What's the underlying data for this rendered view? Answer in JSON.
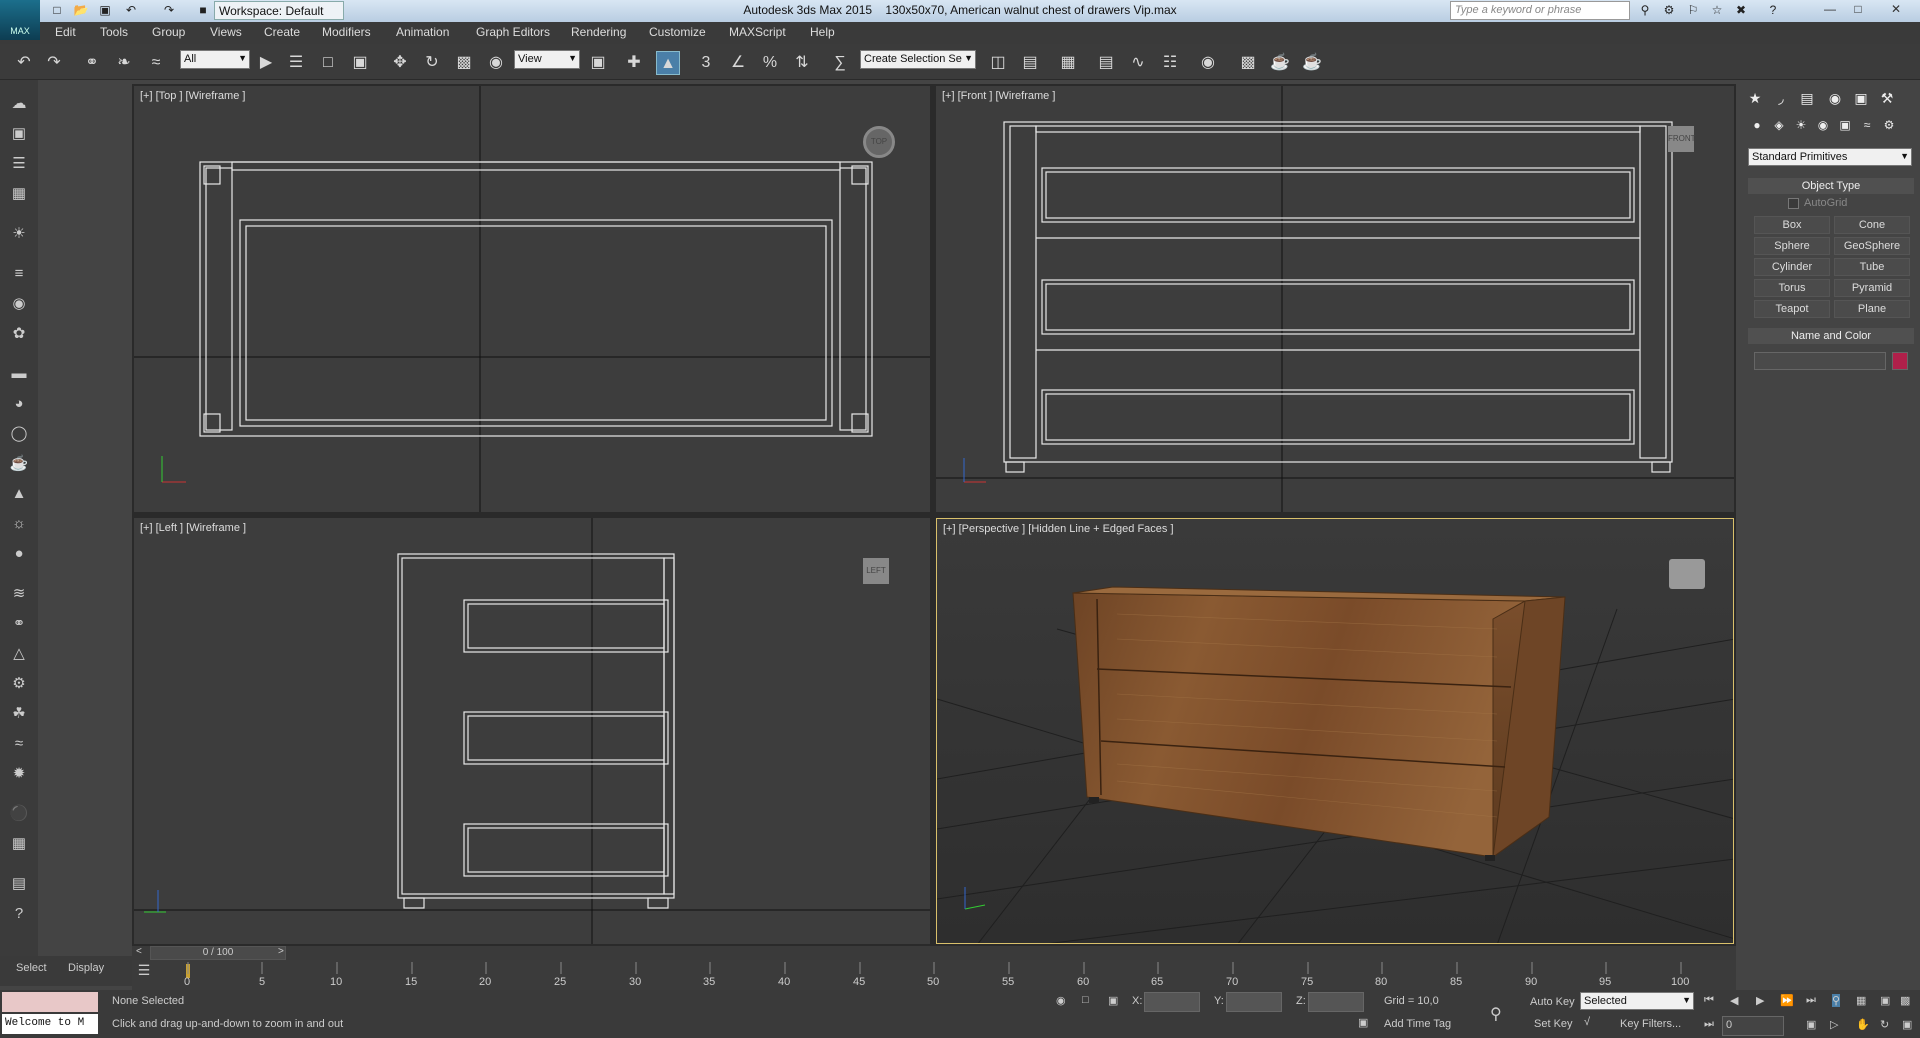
{
  "titlebar": {
    "app_title": "Autodesk 3ds Max  2015",
    "file_title": "130x50x70, American walnut chest of drawers Vip.max",
    "workspace": "Workspace: Default",
    "search_placeholder": "Type a keyword or phrase",
    "logo_text": "MAX"
  },
  "menu": [
    "Edit",
    "Tools",
    "Group",
    "Views",
    "Create",
    "Modifiers",
    "Animation",
    "Graph Editors",
    "Rendering",
    "Customize",
    "MAXScript",
    "Help"
  ],
  "toolbar": {
    "filter": "All",
    "ref_coord": "View",
    "selection_set": "Create Selection Se",
    "angle_snap": "3"
  },
  "viewports": {
    "top": "[+] [Top ] [Wireframe ]",
    "front": "[+] [Front ] [Wireframe ]",
    "left": "[+] [Left ] [Wireframe ]",
    "perspective": "[+] [Perspective ] [Hidden Line + Edged Faces ]",
    "cube_top": "TOP",
    "cube_front": "FRONT",
    "cube_left": "LEFT"
  },
  "panel": {
    "category": "Standard Primitives",
    "object_type": "Object Type",
    "autogrid": "AutoGrid",
    "buttons": [
      "Box",
      "Cone",
      "Sphere",
      "GeoSphere",
      "Cylinder",
      "Tube",
      "Torus",
      "Pyramid",
      "Teapot",
      "Plane"
    ],
    "name_color": "Name and Color",
    "swatch_color": "#b0204a"
  },
  "timeline": {
    "frame": "0 / 100",
    "ticks": [
      "0",
      "5",
      "10",
      "15",
      "20",
      "25",
      "30",
      "35",
      "40",
      "45",
      "50",
      "55",
      "60",
      "65",
      "70",
      "75",
      "80",
      "85",
      "90",
      "95",
      "100"
    ]
  },
  "status": {
    "select_tab": "Select",
    "display_tab": "Display",
    "welcome": "Welcome to M",
    "selection": "None Selected",
    "prompt": "Click and drag up-and-down to zoom in and out",
    "x_label": "X:",
    "y_label": "Y:",
    "z_label": "Z:",
    "grid": "Grid = 10,0",
    "add_time_tag": "Add Time Tag",
    "auto_key": "Auto Key",
    "set_key": "Set Key",
    "key_mode": "Selected",
    "key_filters": "Key Filters...",
    "frame_field": "0"
  }
}
